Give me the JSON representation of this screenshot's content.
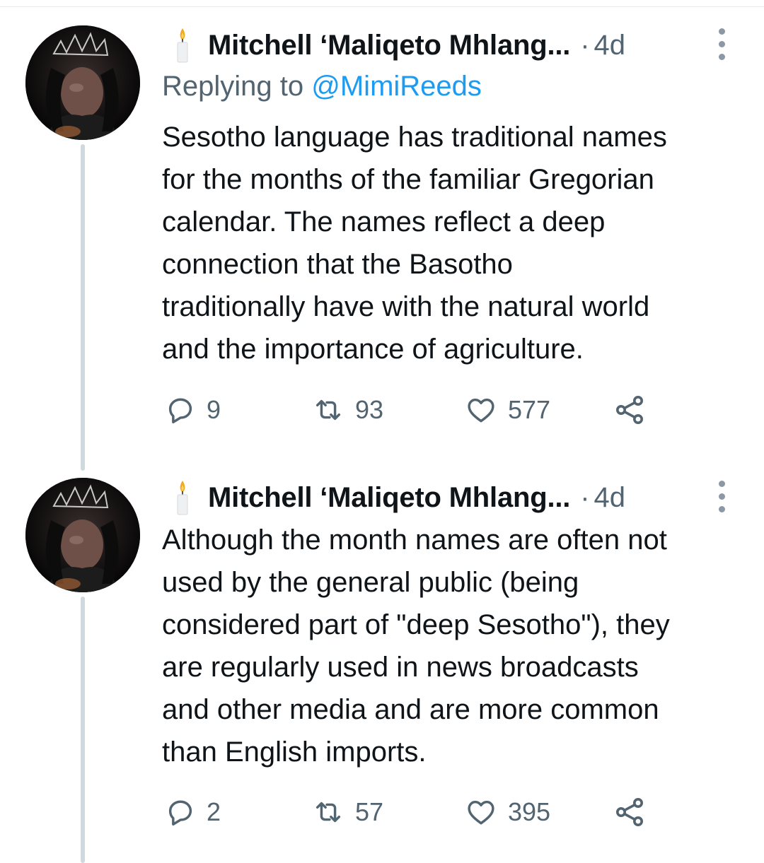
{
  "tweets": [
    {
      "author": "Mitchell ‘Maliqeto Mhlang...",
      "separator": "·",
      "time": "4d",
      "replying_to_label": "Replying to",
      "replying_to_handle": "@MimiReeds",
      "text_lines": [
        "Sesotho language has traditional names",
        "for the months of the familiar Gregorian",
        "calendar. The names reflect a deep",
        "connection that the Basotho",
        "traditionally have with the natural world",
        "and the importance of agriculture."
      ],
      "replies": "9",
      "retweets": "93",
      "likes": "577"
    },
    {
      "author": "Mitchell ‘Maliqeto Mhlang...",
      "separator": "·",
      "time": "4d",
      "text_lines": [
        "Although the month names are often not",
        "used by the general public (being",
        "considered part of \"deep Sesotho\"), they",
        "are regularly used in news broadcasts",
        "and other media and are more common",
        "than English imports."
      ],
      "replies": "2",
      "retweets": "57",
      "likes": "395"
    }
  ],
  "icons": {
    "name_emoji": "candle-icon",
    "reply": "reply-icon",
    "retweet": "retweet-icon",
    "like": "heart-icon",
    "share": "share-icon",
    "more": "more-vertical-icon"
  },
  "colors": {
    "text": "#0f1419",
    "secondary": "#536471",
    "link": "#1d9bf0",
    "thread_line": "#cfd9de"
  }
}
